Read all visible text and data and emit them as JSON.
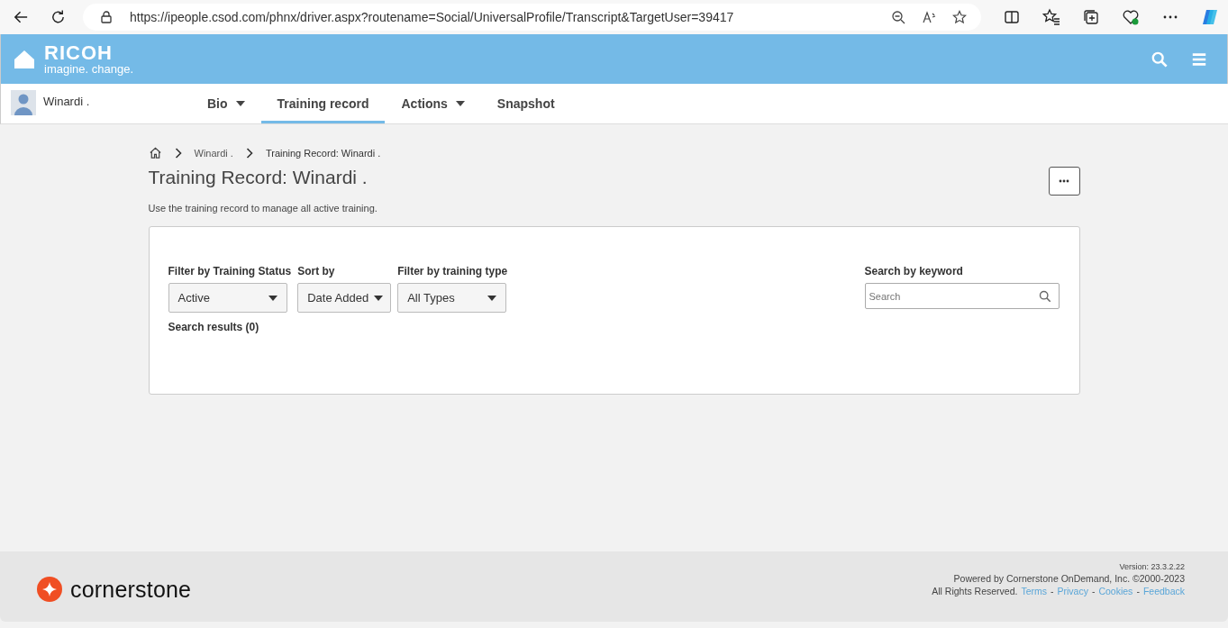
{
  "browser": {
    "url": "https://ipeople.csod.com/phnx/driver.aspx?routename=Social/UniversalProfile/Transcript&TargetUser=39417"
  },
  "header": {
    "logo_name": "RICOH",
    "logo_tagline": "imagine. change."
  },
  "profile": {
    "name": "Winardi ."
  },
  "tabs": [
    {
      "label": "Bio",
      "selected": false,
      "dropdown": true
    },
    {
      "label": "Training record",
      "selected": true,
      "dropdown": false
    },
    {
      "label": "Actions",
      "selected": false,
      "dropdown": true
    },
    {
      "label": "Snapshot",
      "selected": false,
      "dropdown": false
    }
  ],
  "breadcrumb": [
    "Winardi .",
    "Training Record: Winardi ."
  ],
  "title": "Training Record: Winardi .",
  "description": "Use the training record to manage all active training.",
  "filters": [
    {
      "label": "Filter by Training Status",
      "value": "Active"
    },
    {
      "label": "Sort by",
      "value": "Date Added"
    },
    {
      "label": "Filter by training type",
      "value": "All Types"
    }
  ],
  "search": {
    "label": "Search by keyword",
    "placeholder": "Search"
  },
  "results": "Search results (0)",
  "footer": {
    "brand": "cornerstone",
    "version": "Version: 23.3.2.22",
    "powered": "Powered by Cornerstone OnDemand, Inc. ©2000-2023",
    "rights": "All Rights Reserved.",
    "links": [
      "Terms",
      "Privacy",
      "Cookies",
      "Feedback"
    ],
    "separators": [
      "-",
      "-",
      "-"
    ]
  }
}
